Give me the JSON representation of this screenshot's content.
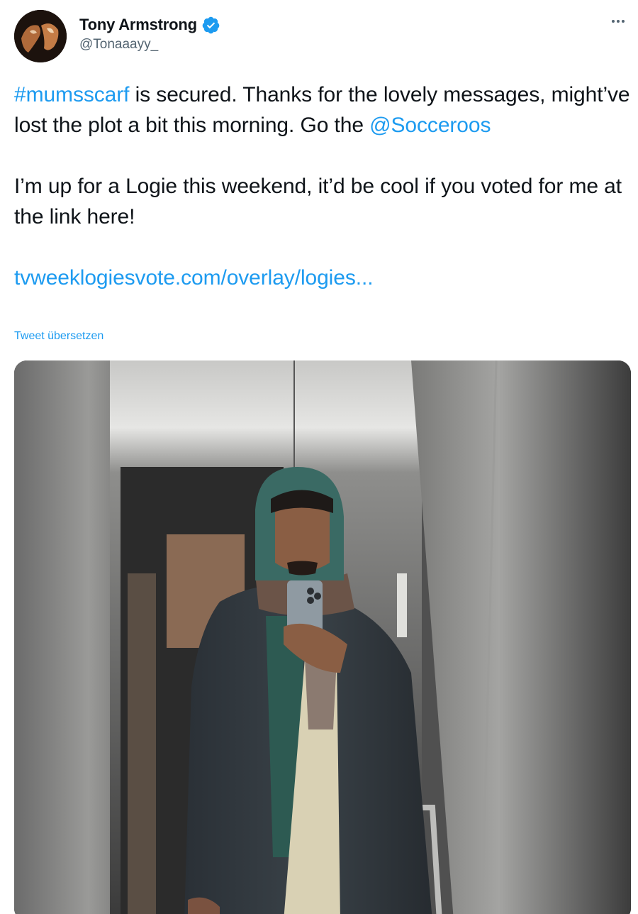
{
  "author": {
    "display_name": "Tony Armstrong",
    "handle": "@Tonaaayy_",
    "verified_icon": "verified-badge-icon",
    "avatar_icon": "avatar"
  },
  "menu": {
    "icon": "more-horizontal-icon"
  },
  "tweet": {
    "p1_hashtag": "#mumsscarf",
    "p1_text_a": " is secured. Thanks for the lovely messages, might’ve lost the plot a bit this morning. Go the ",
    "p1_mention": "@Socceroos",
    "p2_text": "I’m up for a Logie this weekend, it’d be cool if you voted for me at the link here!",
    "link_text": "tvweeklogiesvote.com/overlay/logies...",
    "translate_label": "Tweet übersetzen"
  },
  "media": {
    "description_icon": "elevator-selfie-photo"
  },
  "colors": {
    "link": "#1d9bf0",
    "text": "#0f1419",
    "muted": "#536471"
  }
}
